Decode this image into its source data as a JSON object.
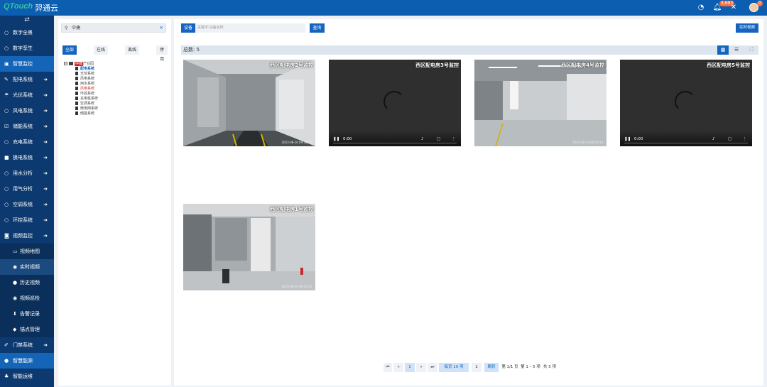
{
  "app": {
    "brand_latin": "QTouch",
    "brand_cn": "羿通云"
  },
  "topbar": {
    "dashboard_icon": "dashboard-icon",
    "bell_icon": "bell-icon",
    "bell_badge": "3,693",
    "tools_icon": "tools-icon",
    "avatar_badge": "0"
  },
  "sidebar": {
    "toggle": "⇄",
    "items": [
      {
        "label": "数字全景",
        "icon": "circle-icon",
        "type": "top"
      },
      {
        "label": "数字孪生",
        "icon": "circle-icon",
        "type": "top"
      },
      {
        "label": "智慧监控",
        "icon": "monitor-icon",
        "type": "group"
      },
      {
        "label": "配电系统",
        "icon": "wrench-icon",
        "type": "menu"
      },
      {
        "label": "光伏系统",
        "icon": "solar-icon",
        "type": "menu"
      },
      {
        "label": "风电系统",
        "icon": "circle-icon",
        "type": "menu"
      },
      {
        "label": "储能系统",
        "icon": "checkbox-icon",
        "type": "menu"
      },
      {
        "label": "充电系统",
        "icon": "circle-icon",
        "type": "menu"
      },
      {
        "label": "换电系统",
        "icon": "square-icon",
        "type": "menu"
      },
      {
        "label": "用水分析",
        "icon": "circle-icon",
        "type": "menu"
      },
      {
        "label": "用气分析",
        "icon": "circle-icon",
        "type": "menu"
      },
      {
        "label": "空调系统",
        "icon": "circle-icon",
        "type": "menu"
      },
      {
        "label": "环控系统",
        "icon": "circle-icon",
        "type": "menu"
      },
      {
        "label": "视频监控",
        "icon": "camera-icon",
        "type": "menu-open"
      },
      {
        "label": "视频地图",
        "icon": "image-icon",
        "type": "sub"
      },
      {
        "label": "实时视频",
        "icon": "eye-icon",
        "type": "sub-active"
      },
      {
        "label": "历史视频",
        "icon": "info-icon",
        "type": "sub"
      },
      {
        "label": "视频巡检",
        "icon": "eye-icon",
        "type": "sub"
      },
      {
        "label": "告警记录",
        "icon": "pin-icon",
        "type": "sub"
      },
      {
        "label": "锚点管理",
        "icon": "tag-icon",
        "type": "sub"
      },
      {
        "label": "门禁系统",
        "icon": "key-icon",
        "type": "menu"
      },
      {
        "label": "智慧能源",
        "icon": "energy-icon",
        "type": "foot"
      },
      {
        "label": "智能运维",
        "icon": "org-icon",
        "type": "foot2"
      }
    ]
  },
  "left_panel": {
    "search_value": "中捷",
    "filters": [
      "全部",
      "在线",
      "离线",
      "停用"
    ],
    "active_filter": "全部",
    "tree_root": {
      "highlight": "中捷",
      "rest": "产业园"
    },
    "tree_children": [
      {
        "label": "配电系统",
        "state": "selected"
      },
      {
        "label": "光伏系统",
        "state": ""
      },
      {
        "label": "风电系统",
        "state": ""
      },
      {
        "label": "用水系统",
        "state": ""
      },
      {
        "label": "风电系统",
        "state": "red"
      },
      {
        "label": "环控系统",
        "state": ""
      },
      {
        "label": "充电桩系统",
        "state": ""
      },
      {
        "label": "空调系统",
        "state": ""
      },
      {
        "label": "微电网系统",
        "state": ""
      },
      {
        "label": "储能系统",
        "state": ""
      }
    ]
  },
  "toolbar": {
    "device_label": "设备",
    "keyword_placeholder": "关键字:设备名称",
    "query_label": "查询",
    "realtime_label": "实时视频",
    "total_text": "总数: 5"
  },
  "videos": [
    {
      "title": "西区配电房2号监控",
      "status": "image",
      "timestamp": "2023-08-16 09:35:52",
      "current_time": "",
      "scene": "corridor"
    },
    {
      "title": "西区配电房3号监控",
      "status": "loading",
      "timestamp": "",
      "current_time": "0:00",
      "scene": ""
    },
    {
      "title": "西区配电房4号监控",
      "status": "image",
      "timestamp": "2023-08-16 09:35:53",
      "current_time": "",
      "scene": "hall"
    },
    {
      "title": "西区配电房5号监控",
      "status": "loading",
      "timestamp": "",
      "current_time": "0:00",
      "scene": ""
    },
    {
      "title": "西区配电房1号监控",
      "status": "image",
      "timestamp": "2023-08-16 09:35:53",
      "current_time": "",
      "scene": "room"
    }
  ],
  "pagination": {
    "first": "⏮",
    "prev": "«",
    "current": "1",
    "next": "»",
    "last": "⏭",
    "page_size": "每页 10 项",
    "jump_value": "1",
    "jump_label": "跳转",
    "page_info": "第 1/1 页",
    "range_info": "第 1 – 5 项",
    "total_info": "共 5 项"
  },
  "colors": {
    "primary": "#1565c0",
    "sidebar": "#0c3a70",
    "topbar": "#0b5eb0"
  }
}
